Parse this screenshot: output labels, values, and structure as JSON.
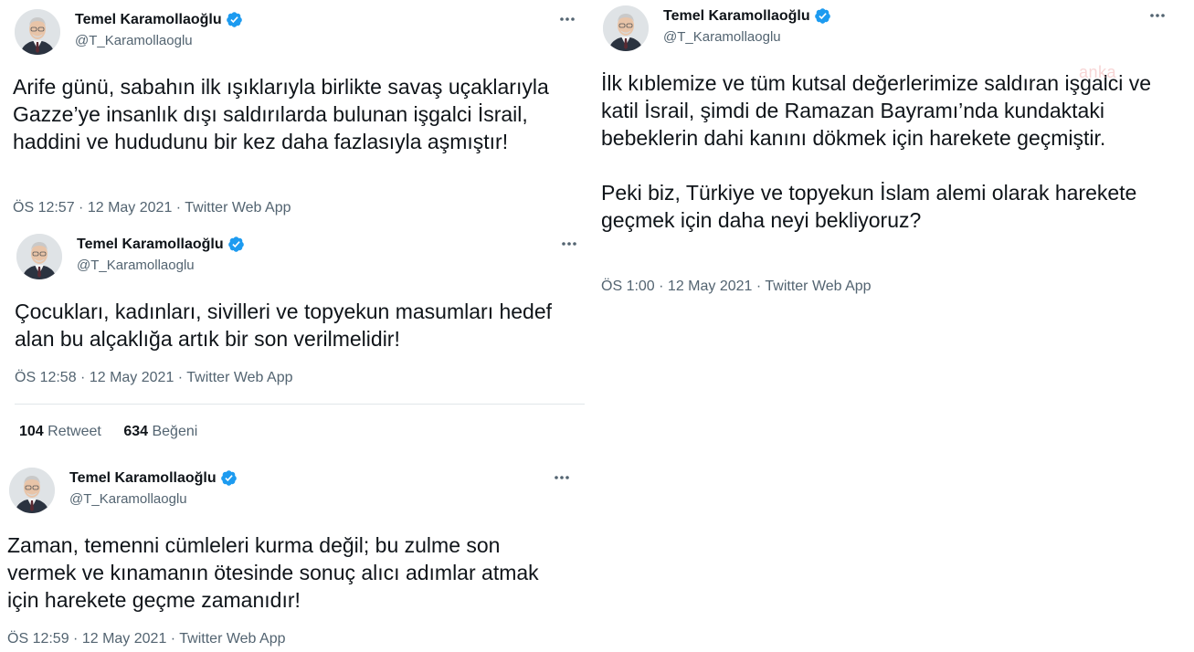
{
  "tweets": [
    {
      "name": "Temel Karamollaoğlu",
      "handle": "@T_Karamollaoglu",
      "text": "Arife günü, sabahın ilk ışıklarıyla birlikte savaş uçaklarıyla Gazze’ye insanlık dışı saldırılarda bulunan işgalci İsrail, haddini ve hududunu bir kez daha fazlasıyla aşmıştır!",
      "time": "ÖS 12:57",
      "date": "12 May 2021",
      "source": "Twitter Web App"
    },
    {
      "name": "Temel Karamollaoğlu",
      "handle": "@T_Karamollaoglu",
      "text": "Çocukları, kadınları, sivilleri ve topyekun masumları hedef alan bu alçaklığa artık bir son verilmelidir!",
      "time": "ÖS 12:58",
      "date": "12 May 2021",
      "source": "Twitter Web App",
      "retweets": "104",
      "retweets_label": "Retweet",
      "likes": "634",
      "likes_label": "Beğeni"
    },
    {
      "name": "Temel Karamollaoğlu",
      "handle": "@T_Karamollaoglu",
      "text": "Zaman, temenni cümleleri kurma değil; bu zulme son vermek ve kınamanın ötesinde sonuç alıcı adımlar atmak için harekete geçme zamanıdır!",
      "time": "ÖS 12:59",
      "date": "12 May 2021",
      "source": "Twitter Web App"
    },
    {
      "name": "Temel Karamollaoğlu",
      "handle": "@T_Karamollaoglu",
      "text_p1": "İlk kıblemize ve tüm kutsal değerlerimize saldıran işgalci ve katil İsrail, şimdi de Ramazan Bayramı’nda kundaktaki bebeklerin dahi kanını dökmek için harekete geçmiştir.",
      "text_p2": "Peki biz, Türkiye ve topyekun İslam alemi olarak harekete geçmek için daha neyi bekliyoruz?",
      "time": "ÖS 1:00",
      "date": "12 May 2021",
      "source": "Twitter Web App"
    }
  ],
  "separator": " · ",
  "watermark": "anka",
  "colors": {
    "text": "#0f1419",
    "secondary": "#536471",
    "verified": "#1d9bf0",
    "divider": "#e1e6ea"
  },
  "icons": {
    "verified": "verified-badge-icon",
    "more": "more-dots-icon"
  }
}
